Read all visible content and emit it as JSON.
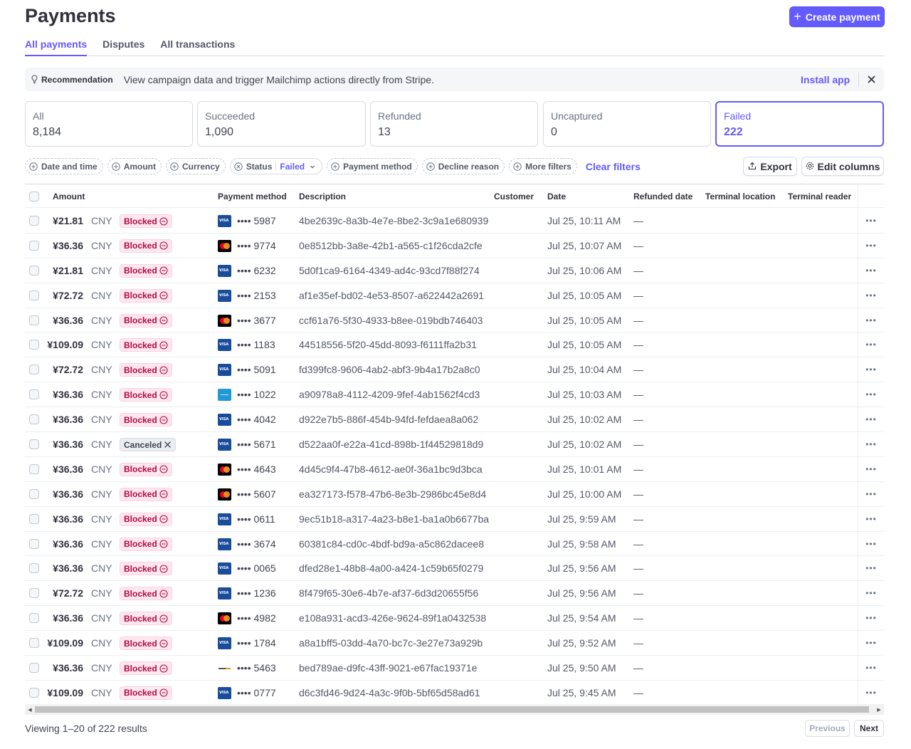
{
  "page": {
    "title": "Payments",
    "create_button": "Create payment"
  },
  "tabs": [
    "All payments",
    "Disputes",
    "All transactions"
  ],
  "recommendation": {
    "label": "Recommendation",
    "text": "View campaign data and trigger Mailchimp actions directly from Stripe.",
    "action": "Install app"
  },
  "status_cards": [
    {
      "label": "All",
      "count": "8,184"
    },
    {
      "label": "Succeeded",
      "count": "1,090"
    },
    {
      "label": "Refunded",
      "count": "13"
    },
    {
      "label": "Uncaptured",
      "count": "0"
    },
    {
      "label": "Failed",
      "count": "222"
    }
  ],
  "filters": {
    "date_and_time": "Date and time",
    "amount": "Amount",
    "currency": "Currency",
    "status_label": "Status",
    "status_value": "Failed",
    "payment_method": "Payment method",
    "decline_reason": "Decline reason",
    "more_filters": "More filters",
    "clear_filters": "Clear filters",
    "export": "Export",
    "edit_columns": "Edit columns"
  },
  "columns": {
    "amount": "Amount",
    "payment_method": "Payment method",
    "description": "Description",
    "customer": "Customer",
    "date": "Date",
    "refunded_date": "Refunded date",
    "terminal_location": "Terminal location",
    "terminal_reader": "Terminal reader"
  },
  "rows": [
    {
      "amount": "¥21.81",
      "currency": "CNY",
      "status": "Blocked",
      "brand": "visa",
      "last4": "•••• 5987",
      "description": "4be2639c-8a3b-4e7e-8be2-3c9a1e680939",
      "date": "Jul 25, 10:11 AM",
      "refunded": "—"
    },
    {
      "amount": "¥36.36",
      "currency": "CNY",
      "status": "Blocked",
      "brand": "mastercard",
      "last4": "•••• 9774",
      "description": "0e8512bb-3a8e-42b1-a565-c1f26cda2cfe",
      "date": "Jul 25, 10:07 AM",
      "refunded": "—"
    },
    {
      "amount": "¥21.81",
      "currency": "CNY",
      "status": "Blocked",
      "brand": "visa",
      "last4": "•••• 6232",
      "description": "5d0f1ca9-6164-4349-ad4c-93cd7f88f274",
      "date": "Jul 25, 10:06 AM",
      "refunded": "—"
    },
    {
      "amount": "¥72.72",
      "currency": "CNY",
      "status": "Blocked",
      "brand": "visa",
      "last4": "•••• 2153",
      "description": "af1e35ef-bd02-4e53-8507-a622442a2691",
      "date": "Jul 25, 10:05 AM",
      "refunded": "—"
    },
    {
      "amount": "¥36.36",
      "currency": "CNY",
      "status": "Blocked",
      "brand": "mastercard",
      "last4": "•••• 3677",
      "description": "ccf61a76-5f30-4933-b8ee-019bdb746403",
      "date": "Jul 25, 10:05 AM",
      "refunded": "—"
    },
    {
      "amount": "¥109.09",
      "currency": "CNY",
      "status": "Blocked",
      "brand": "visa",
      "last4": "•••• 1183",
      "description": "44518556-5f20-45dd-8093-f6111ffa2b31",
      "date": "Jul 25, 10:05 AM",
      "refunded": "—"
    },
    {
      "amount": "¥72.72",
      "currency": "CNY",
      "status": "Blocked",
      "brand": "visa",
      "last4": "•••• 5091",
      "description": "fd399fc8-9606-4ab2-abf3-9b4a17b2a8c0",
      "date": "Jul 25, 10:04 AM",
      "refunded": "—"
    },
    {
      "amount": "¥36.36",
      "currency": "CNY",
      "status": "Blocked",
      "brand": "amex",
      "last4": "•••• 1022",
      "description": "a90978a8-4112-4209-9fef-4ab1562f4cd3",
      "date": "Jul 25, 10:03 AM",
      "refunded": "—"
    },
    {
      "amount": "¥36.36",
      "currency": "CNY",
      "status": "Blocked",
      "brand": "visa",
      "last4": "•••• 4042",
      "description": "d922e7b5-886f-454b-94fd-fefdaea8a062",
      "date": "Jul 25, 10:02 AM",
      "refunded": "—"
    },
    {
      "amount": "¥36.36",
      "currency": "CNY",
      "status": "Canceled",
      "brand": "visa",
      "last4": "•••• 5671",
      "description": "d522aa0f-e22a-41cd-898b-1f44529818d9",
      "date": "Jul 25, 10:02 AM",
      "refunded": "—"
    },
    {
      "amount": "¥36.36",
      "currency": "CNY",
      "status": "Blocked",
      "brand": "mastercard",
      "last4": "•••• 4643",
      "description": "4d45c9f4-47b8-4612-ae0f-36a1bc9d3bca",
      "date": "Jul 25, 10:01 AM",
      "refunded": "—"
    },
    {
      "amount": "¥36.36",
      "currency": "CNY",
      "status": "Blocked",
      "brand": "mastercard",
      "last4": "•••• 5607",
      "description": "ea327173-f578-47b6-8e3b-2986bc45e8d4",
      "date": "Jul 25, 10:00 AM",
      "refunded": "—"
    },
    {
      "amount": "¥36.36",
      "currency": "CNY",
      "status": "Blocked",
      "brand": "visa",
      "last4": "•••• 0611",
      "description": "9ec51b18-a317-4a23-b8e1-ba1a0b6677ba",
      "date": "Jul 25, 9:59 AM",
      "refunded": "—"
    },
    {
      "amount": "¥36.36",
      "currency": "CNY",
      "status": "Blocked",
      "brand": "visa",
      "last4": "•••• 3674",
      "description": "60381c84-cd0c-4bdf-bd9a-a5c862dacee8",
      "date": "Jul 25, 9:58 AM",
      "refunded": "—"
    },
    {
      "amount": "¥36.36",
      "currency": "CNY",
      "status": "Blocked",
      "brand": "visa",
      "last4": "•••• 0065",
      "description": "dfed28e1-48b8-4a00-a424-1c59b65f0279",
      "date": "Jul 25, 9:56 AM",
      "refunded": "—"
    },
    {
      "amount": "¥72.72",
      "currency": "CNY",
      "status": "Blocked",
      "brand": "visa",
      "last4": "•••• 1236",
      "description": "8f479f65-30e6-4b7e-af37-6d3d20655f56",
      "date": "Jul 25, 9:56 AM",
      "refunded": "—"
    },
    {
      "amount": "¥36.36",
      "currency": "CNY",
      "status": "Blocked",
      "brand": "mastercard",
      "last4": "•••• 4982",
      "description": "e108a931-acd3-426e-9624-89f1a0432538",
      "date": "Jul 25, 9:54 AM",
      "refunded": "—"
    },
    {
      "amount": "¥109.09",
      "currency": "CNY",
      "status": "Blocked",
      "brand": "visa",
      "last4": "•••• 1784",
      "description": "a8a1bff5-03dd-4a70-bc7c-3e27e73a929b",
      "date": "Jul 25, 9:52 AM",
      "refunded": "—"
    },
    {
      "amount": "¥36.36",
      "currency": "CNY",
      "status": "Blocked",
      "brand": "discover",
      "last4": "•••• 5463",
      "description": "bed789ae-d9fc-43ff-9021-e67fac19371e",
      "date": "Jul 25, 9:50 AM",
      "refunded": "—"
    },
    {
      "amount": "¥109.09",
      "currency": "CNY",
      "status": "Blocked",
      "brand": "visa",
      "last4": "•••• 0777",
      "description": "d6c3fd46-9d24-4a3c-9f0b-5bf65d58ad61",
      "date": "Jul 25, 9:45 AM",
      "refunded": "—"
    }
  ],
  "footer": {
    "viewing": "Viewing 1–20 of 222 results",
    "previous": "Previous",
    "next": "Next"
  },
  "colors": {
    "accent": "#635bff",
    "blocked_text": "#b3093c",
    "blocked_bg": "#ffe7f2"
  }
}
